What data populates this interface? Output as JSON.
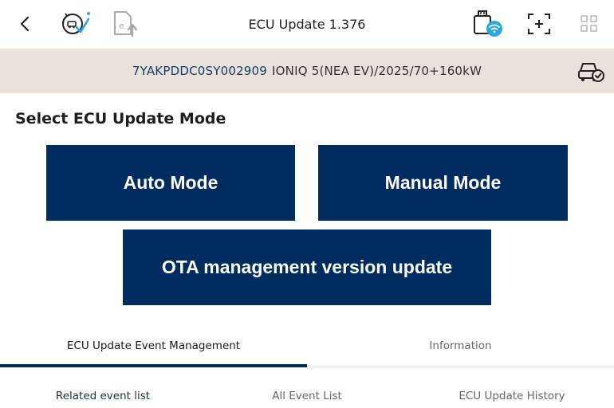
{
  "header": {
    "title": "ECU Update 1.376",
    "icons": [
      "back-arrow-icon",
      "vehicle-check-icon",
      "export-icon",
      "wireless-vci-icon",
      "screenshot-icon",
      "grid-menu-icon"
    ]
  },
  "vehicle": {
    "vin": "7YAKPDDC0SY002909",
    "model": "IONIQ 5(NEA EV)/2025/70+160kW",
    "icon": "car-check-icon"
  },
  "section": {
    "title": "Select ECU Update Mode"
  },
  "modes": {
    "auto": "Auto Mode",
    "manual": "Manual Mode",
    "ota": "OTA management version update"
  },
  "tabs": [
    {
      "label": "ECU Update Event Management",
      "active": true
    },
    {
      "label": "Information",
      "active": false
    }
  ],
  "subtabs": [
    {
      "label": "Related event list",
      "active": true
    },
    {
      "label": "All Event List",
      "active": false
    },
    {
      "label": "ECU Update History",
      "active": false
    }
  ],
  "colors": {
    "accent": "#002c5f",
    "vehicle_bar": "#e8e2db",
    "check": "#29a8e0"
  }
}
